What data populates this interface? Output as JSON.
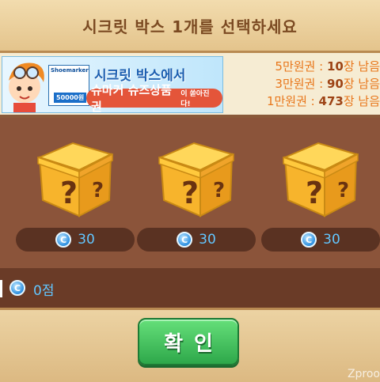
{
  "header": {
    "title": "시크릿 박스 1개를 선택하세요"
  },
  "banner": {
    "line1": "시크릿 박스에서",
    "line2_main": "슈마커 슈즈상품권",
    "line2_suffix": "이 쏟아진다!",
    "card_brand": "Shoemarker",
    "card_amount": "50000원"
  },
  "stock": [
    {
      "label": "5만원권 : ",
      "count": "10",
      "unit": "장 남음"
    },
    {
      "label": "3만원권 : ",
      "count": "90",
      "unit": "장 남음"
    },
    {
      "label": "1만원권 : ",
      "count": "473",
      "unit": "장 남음"
    }
  ],
  "boxes": [
    {
      "coin_symbol": "C",
      "price": "30"
    },
    {
      "coin_symbol": "C",
      "price": "30"
    },
    {
      "coin_symbol": "C",
      "price": "30"
    }
  ],
  "score": {
    "coin_symbol": "C",
    "value": "0점"
  },
  "footer": {
    "confirm_label": "확인"
  },
  "watermark": "Zproo",
  "colors": {
    "accent_price": "#62c6ff",
    "stock_text": "#e8761a",
    "confirm_button": "#3cb858",
    "panel_bg": "#8b543a"
  }
}
